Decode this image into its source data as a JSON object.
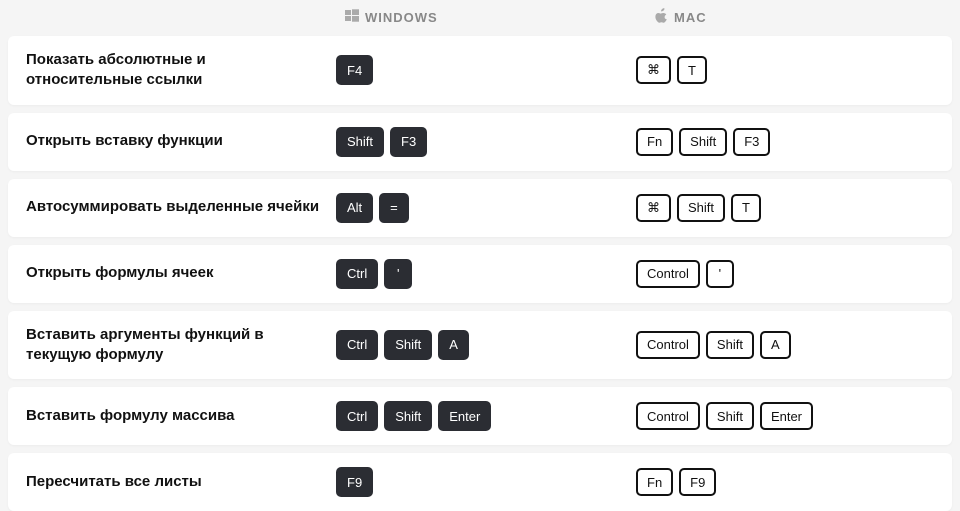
{
  "header": {
    "windows_label": "WINDOWS",
    "mac_label": "MAC"
  },
  "rows": [
    {
      "desc": "Показать абсолютные и относительные ссылки",
      "win": [
        "F4"
      ],
      "mac": [
        "⌘",
        "T"
      ]
    },
    {
      "desc": "Открыть вставку функции",
      "win": [
        "Shift",
        "F3"
      ],
      "mac": [
        "Fn",
        "Shift",
        "F3"
      ]
    },
    {
      "desc": "Автосуммировать выделенные ячейки",
      "win": [
        "Alt",
        "="
      ],
      "mac": [
        "⌘",
        "Shift",
        "T"
      ]
    },
    {
      "desc": "Открыть формулы ячеек",
      "win": [
        "Ctrl",
        "'"
      ],
      "mac": [
        "Control",
        "'"
      ]
    },
    {
      "desc": "Вставить аргументы функций в текущую формулу",
      "win": [
        "Ctrl",
        "Shift",
        "A"
      ],
      "mac": [
        "Control",
        "Shift",
        "A"
      ]
    },
    {
      "desc": "Вставить формулу массива",
      "win": [
        "Ctrl",
        "Shift",
        "Enter"
      ],
      "mac": [
        "Control",
        "Shift",
        "Enter"
      ]
    },
    {
      "desc": "Пересчитать все листы",
      "win": [
        "F9"
      ],
      "mac": [
        "Fn",
        "F9"
      ]
    }
  ]
}
